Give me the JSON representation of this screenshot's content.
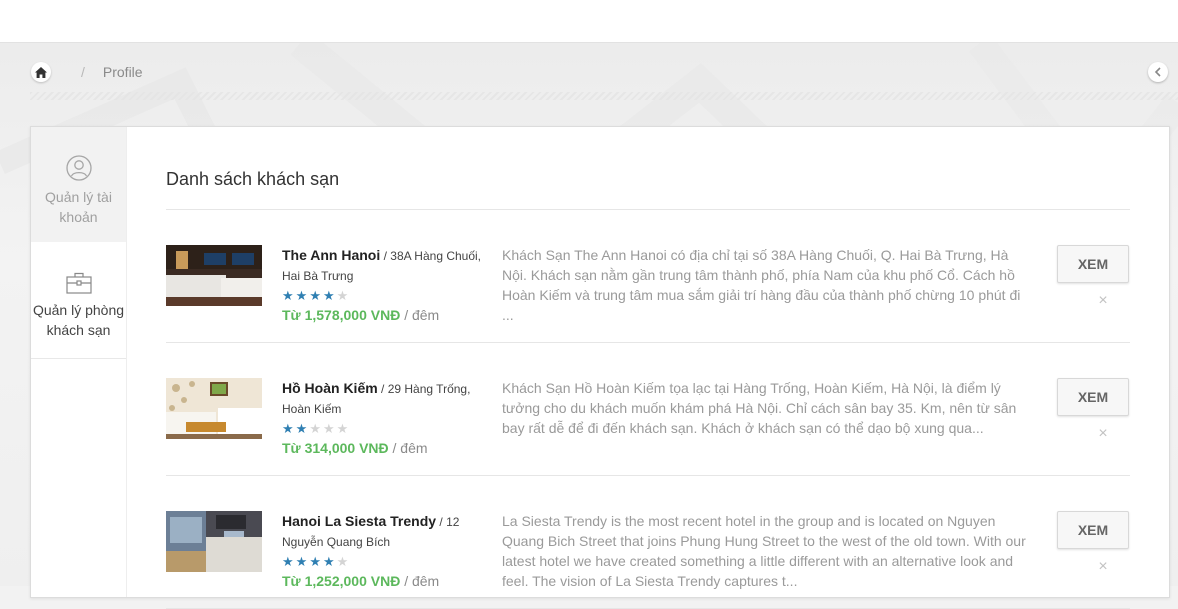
{
  "breadcrumb": {
    "home_icon": "home-icon",
    "separator": "/",
    "current": "Profile"
  },
  "sidebar": {
    "items": [
      {
        "label": "Quản lý tài khoản",
        "icon": "user-circle-icon",
        "active": true
      },
      {
        "label": "Quản lý phòng khách sạn",
        "icon": "briefcase-icon",
        "active": false
      }
    ]
  },
  "main": {
    "title": "Danh sách khách sạn",
    "hotels": [
      {
        "name": "The Ann Hanoi",
        "address": "/ 38A Hàng Chuối, Hai Bà Trưng",
        "rating": 4,
        "price": "Từ 1,578,000 VNĐ",
        "per": "/ đêm",
        "description": "Khách Sạn The Ann Hanoi có địa chỉ tại số 38A Hàng Chuối, Q. Hai Bà Trưng, Hà Nội. Khách sạn nằm gần trung tâm thành phố, phía Nam của khu phố Cổ. Cách hồ Hoàn Kiếm và trung tâm mua sắm giải trí hàng đầu của thành phố chừng 10 phút đi ...",
        "view_label": "XEM",
        "delete_label": "×"
      },
      {
        "name": "Hồ Hoàn Kiếm",
        "address": "/ 29 Hàng Trống, Hoàn Kiếm",
        "rating": 2,
        "price": "Từ 314,000 VNĐ",
        "per": "/ đêm",
        "description": "Khách Sạn Hồ Hoàn Kiếm tọa lạc tại Hàng Trống, Hoàn Kiếm, Hà Nội, là điểm lý tưởng cho du khách muốn khám phá Hà Nội. Chỉ cách sân bay 35. Km, nên từ sân bay rất dễ để đi đến khách sạn. Khách ở khách sạn có thể dạo bộ xung qua...",
        "view_label": "XEM",
        "delete_label": "×"
      },
      {
        "name": "Hanoi La Siesta Trendy",
        "address": "/ 12 Nguyễn Quang Bích",
        "rating": 4,
        "price": "Từ 1,252,000 VNĐ",
        "per": "/ đêm",
        "description": "La Siesta Trendy is the most recent hotel in the group and is located on Nguyen Quang Bich Street that joins Phung Hung Street to the west of the old town. With our latest hotel we have created something a little different with an alternative look and feel. The vision of La Siesta Trendy captures t...",
        "view_label": "XEM",
        "delete_label": "×"
      }
    ]
  },
  "colors": {
    "price_green": "#5cb85c",
    "star_blue": "#2f7fb2",
    "star_gray": "#d4d4d4"
  }
}
